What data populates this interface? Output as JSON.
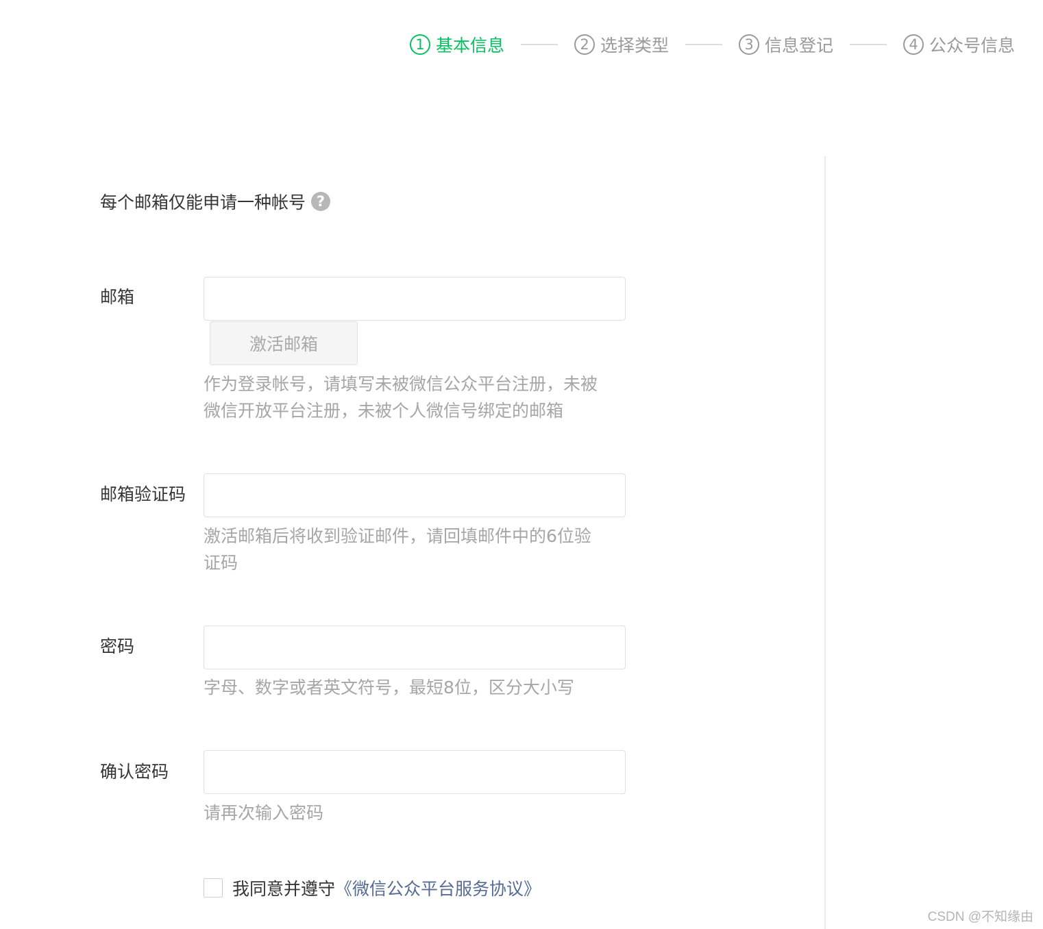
{
  "stepper": {
    "steps": [
      {
        "number": "1",
        "label": "基本信息",
        "active": true
      },
      {
        "number": "2",
        "label": "选择类型",
        "active": false
      },
      {
        "number": "3",
        "label": "信息登记",
        "active": false
      },
      {
        "number": "4",
        "label": "公众号信息",
        "active": false
      }
    ]
  },
  "notice": {
    "text": "每个邮箱仅能申请一种帐号",
    "help_icon": "?"
  },
  "form": {
    "email": {
      "label": "邮箱",
      "value": "",
      "placeholder": "",
      "activate_button": "激活邮箱",
      "hint": "作为登录帐号，请填写未被微信公众平台注册，未被微信开放平台注册，未被个人微信号绑定的邮箱"
    },
    "verify_code": {
      "label": "邮箱验证码",
      "value": "",
      "placeholder": "",
      "hint": "激活邮箱后将收到验证邮件，请回填邮件中的6位验证码"
    },
    "password": {
      "label": "密码",
      "value": "",
      "placeholder": "",
      "hint": "字母、数字或者英文符号，最短8位，区分大小写"
    },
    "confirm_password": {
      "label": "确认密码",
      "value": "",
      "placeholder": "",
      "hint": "请再次输入密码"
    }
  },
  "agreement": {
    "checked": false,
    "text": "我同意并遵守",
    "link": "《微信公众平台服务协议》"
  },
  "watermark": "CSDN @不知缘由",
  "colors": {
    "active": "#07c160",
    "inactive": "#9a9a9a",
    "link": "#576b95",
    "hint": "#a6a6a6"
  }
}
